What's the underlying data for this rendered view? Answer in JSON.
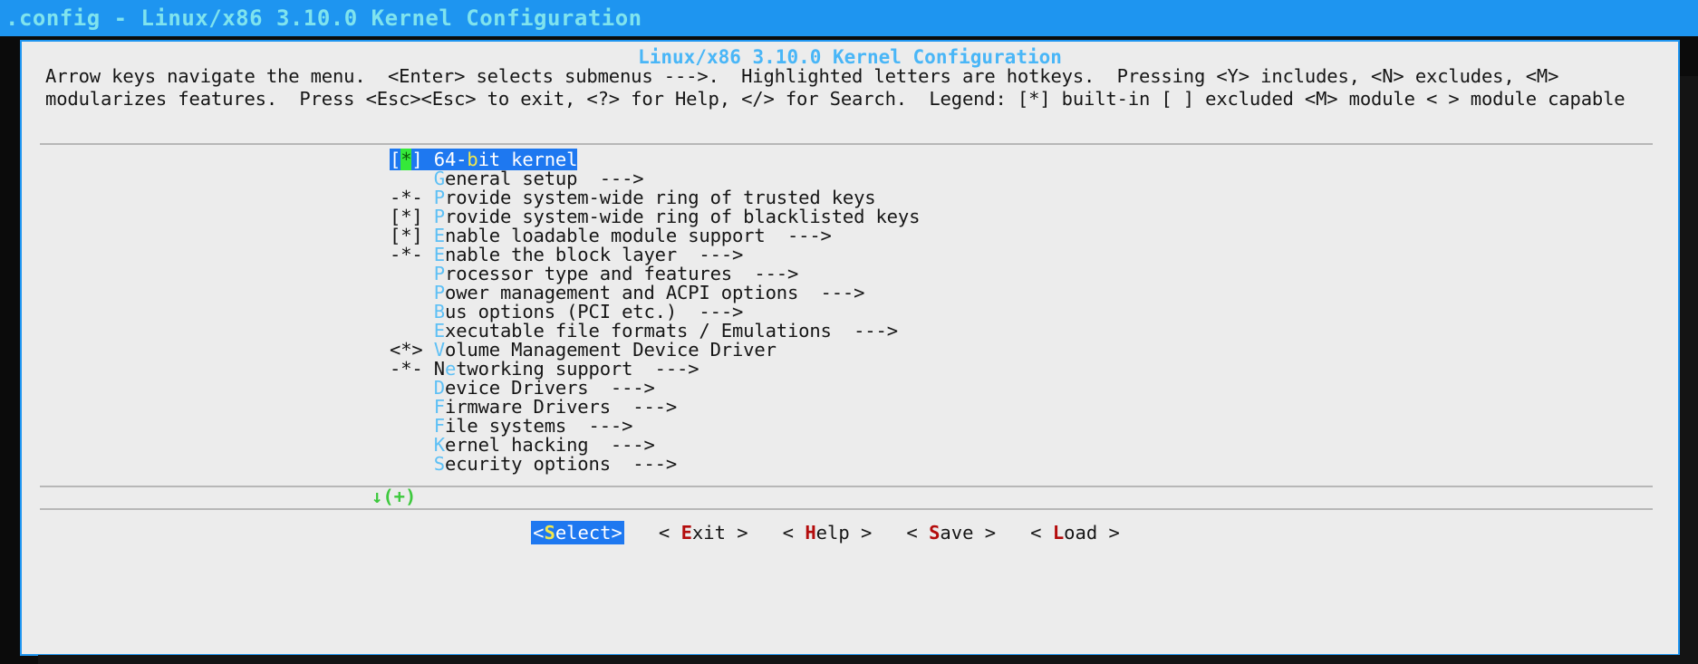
{
  "window": {
    "title": ".config - Linux/x86 3.10.0 Kernel Configuration",
    "titlebar_bg": "#1e95f0",
    "titlebar_fg": "#7fe3ee"
  },
  "dialog": {
    "title": "Linux/x86 3.10.0 Kernel Configuration",
    "title_color": "#49b6f7",
    "help_line_1": "Arrow keys navigate the menu.  <Enter> selects submenus --->.  Highlighted letters are hotkeys.  Pressing <Y> includes, <N> excludes, <M>",
    "help_line_2": "modularizes features.  Press <Esc><Esc> to exit, <?> for Help, </> for Search.  Legend: [*] built-in [ ] excluded <M> module < > module capable"
  },
  "menu": {
    "scroll_indicator": "↓(+)",
    "selected_index": 0,
    "items": [
      {
        "marker": "[",
        "state": "*",
        "marker_end": "] ",
        "pre": "64-",
        "hotkey": "b",
        "post": "it kernel",
        "arrow": ""
      },
      {
        "marker": " ",
        "state": " ",
        "marker_end": "  ",
        "pre": "",
        "hotkey": "G",
        "post": "eneral setup",
        "arrow": "  --->"
      },
      {
        "marker": "-",
        "state": "*",
        "marker_end": "- ",
        "pre": "",
        "hotkey": "P",
        "post": "rovide system-wide ring of trusted keys",
        "arrow": ""
      },
      {
        "marker": "[",
        "state": "*",
        "marker_end": "] ",
        "pre": "",
        "hotkey": "P",
        "post": "rovide system-wide ring of blacklisted keys",
        "arrow": ""
      },
      {
        "marker": "[",
        "state": "*",
        "marker_end": "] ",
        "pre": "",
        "hotkey": "E",
        "post": "nable loadable module support",
        "arrow": "  --->"
      },
      {
        "marker": "-",
        "state": "*",
        "marker_end": "- ",
        "pre": "",
        "hotkey": "E",
        "post": "nable the block layer",
        "arrow": "  --->"
      },
      {
        "marker": " ",
        "state": " ",
        "marker_end": "  ",
        "pre": "",
        "hotkey": "P",
        "post": "rocessor type and features",
        "arrow": "  --->"
      },
      {
        "marker": " ",
        "state": " ",
        "marker_end": "  ",
        "pre": "",
        "hotkey": "P",
        "post": "ower management and ACPI options",
        "arrow": "  --->"
      },
      {
        "marker": " ",
        "state": " ",
        "marker_end": "  ",
        "pre": "",
        "hotkey": "B",
        "post": "us options (PCI etc.)",
        "arrow": "  --->"
      },
      {
        "marker": " ",
        "state": " ",
        "marker_end": "  ",
        "pre": "",
        "hotkey": "E",
        "post": "xecutable file formats / Emulations",
        "arrow": "  --->"
      },
      {
        "marker": "<",
        "state": "*",
        "marker_end": "> ",
        "pre": "",
        "hotkey": "V",
        "post": "olume Management Device Driver",
        "arrow": ""
      },
      {
        "marker": "-",
        "state": "*",
        "marker_end": "- ",
        "pre": "N",
        "hotkey": "e",
        "post": "tworking support",
        "arrow": "  --->"
      },
      {
        "marker": " ",
        "state": " ",
        "marker_end": "  ",
        "pre": "",
        "hotkey": "D",
        "post": "evice Drivers",
        "arrow": "  --->"
      },
      {
        "marker": " ",
        "state": " ",
        "marker_end": "  ",
        "pre": "",
        "hotkey": "F",
        "post": "irmware Drivers",
        "arrow": "  --->"
      },
      {
        "marker": " ",
        "state": " ",
        "marker_end": "  ",
        "pre": "",
        "hotkey": "F",
        "post": "ile systems",
        "arrow": "  --->"
      },
      {
        "marker": " ",
        "state": " ",
        "marker_end": "  ",
        "pre": "",
        "hotkey": "K",
        "post": "ernel hacking",
        "arrow": "  --->"
      },
      {
        "marker": " ",
        "state": " ",
        "marker_end": "  ",
        "pre": "",
        "hotkey": "S",
        "post": "ecurity options",
        "arrow": "  --->"
      }
    ]
  },
  "buttons": [
    {
      "left": "<",
      "pre": "",
      "hotkey": "S",
      "post": "elect",
      "right": ">",
      "active": true
    },
    {
      "left": "< ",
      "pre": "",
      "hotkey": "E",
      "post": "xit",
      "right": " >",
      "active": false
    },
    {
      "left": "< ",
      "pre": "",
      "hotkey": "H",
      "post": "elp",
      "right": " >",
      "active": false
    },
    {
      "left": "< ",
      "pre": "",
      "hotkey": "S",
      "post": "ave",
      "right": " >",
      "active": false
    },
    {
      "left": "< ",
      "pre": "",
      "hotkey": "L",
      "post": "oad",
      "right": " >",
      "active": false
    }
  ]
}
